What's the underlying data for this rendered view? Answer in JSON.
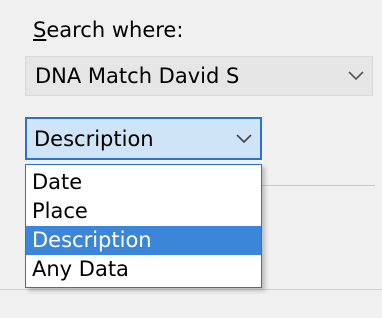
{
  "search_where": {
    "label_mnemonic": "S",
    "label_rest": "earch where:",
    "value": "DNA Match David S"
  },
  "field_combo": {
    "value": "Description",
    "options": [
      "Date",
      "Place",
      "Description",
      "Any Data"
    ],
    "selected_index": 2
  },
  "icons": {
    "dropdown": "chevron-down-icon"
  },
  "colors": {
    "focus_border": "#2f74c4",
    "selection": "#3b86d8"
  }
}
